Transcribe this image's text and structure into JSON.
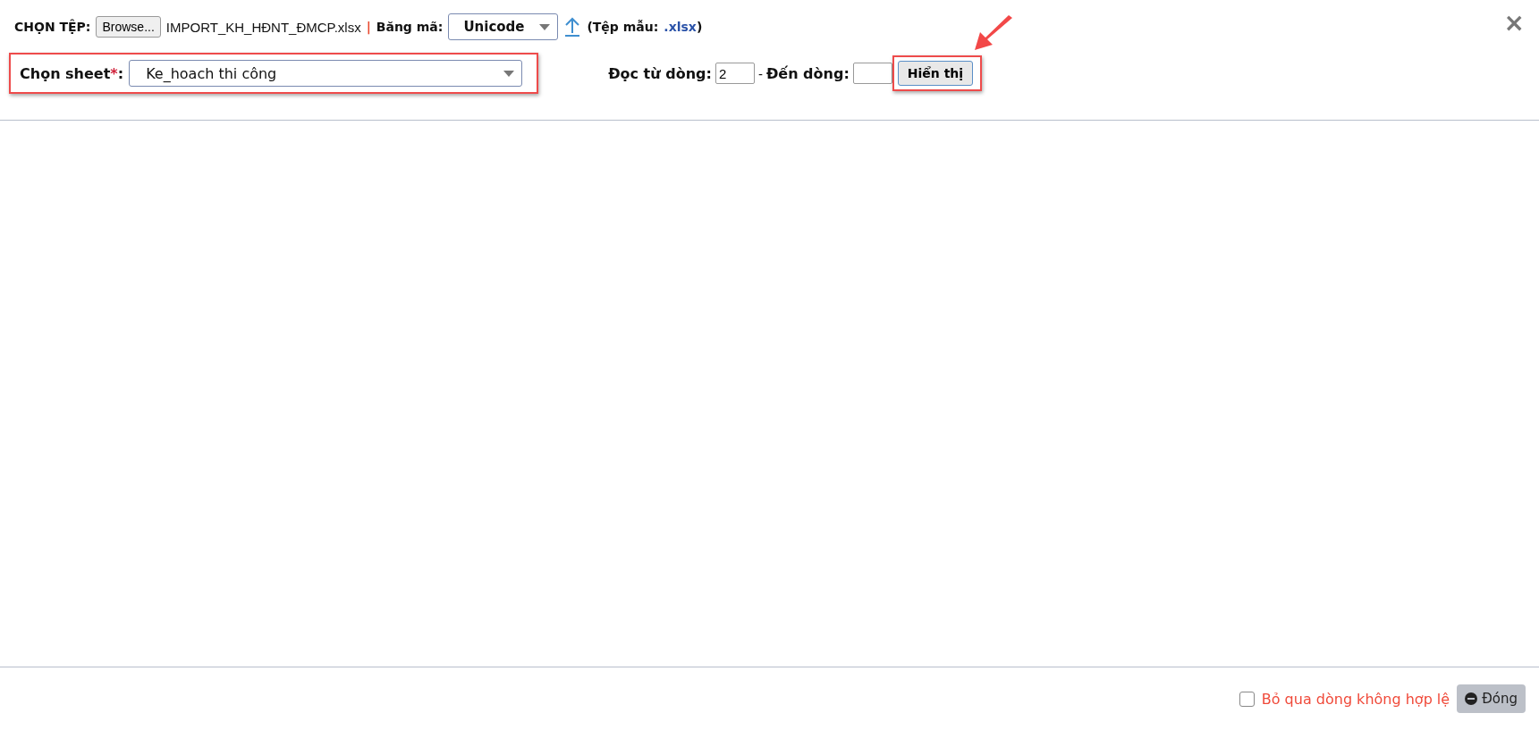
{
  "file_row": {
    "label": "CHỌN TỆP:",
    "browse_button": "Browse...",
    "file_name": "IMPORT_KH_HĐNT_ĐMCP.xlsx",
    "separator": "|",
    "encoding_label": "Băng mã:",
    "encoding_value": "Unicode",
    "template_open": "(Tệp mẫu:",
    "template_link": ".xlsx",
    "template_close": ")"
  },
  "close_button": "×",
  "sheet": {
    "label": "Chọn sheet",
    "required_mark": "*",
    "colon": ":",
    "value": "Ke_hoach thi công",
    "highlighted": true
  },
  "range": {
    "from_label": "Đọc từ dòng:",
    "from_value": "2",
    "dash": "-",
    "to_label": "Đến dòng:",
    "show_button": "Hiển thị",
    "highlighted": true
  },
  "footer": {
    "skip_invalid": {
      "label": "Bỏ qua dòng không hợp lệ",
      "checked": false
    },
    "close_button": "Đóng"
  }
}
